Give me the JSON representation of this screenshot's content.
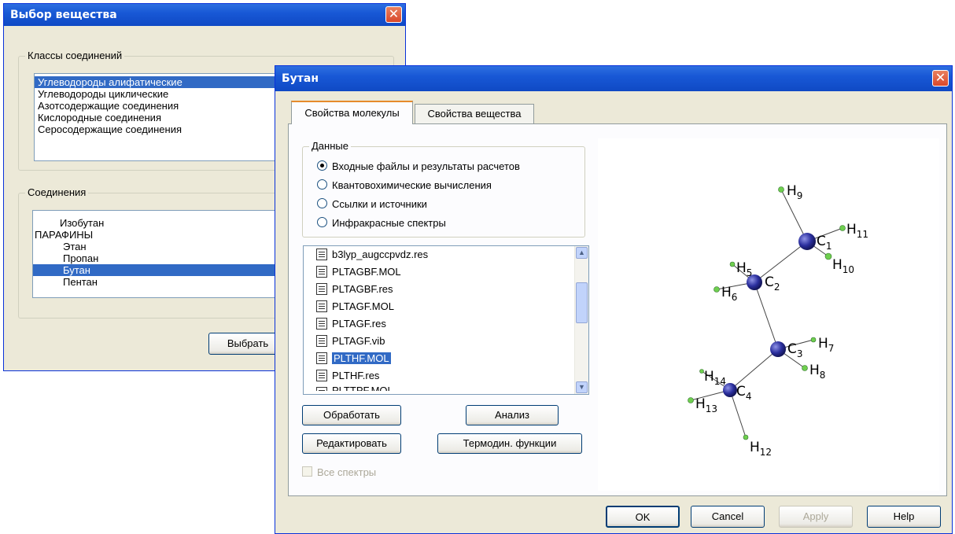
{
  "back_dialog": {
    "title": "Выбор вещества",
    "close": "✕",
    "classes_group": "Классы соединений",
    "classes": [
      "Углеводороды алифатические",
      "Углеводороды циклические",
      "Азотсодержащие соединения",
      "Кислородные соединения",
      "Серосодержащие соединения"
    ],
    "compounds_group": "Соединения",
    "compounds": [
      "Изобутан",
      "ПАРАФИНЫ",
      "Этан",
      "Пропан",
      "Бутан",
      "Пентан"
    ],
    "select_button": "Выбрать"
  },
  "front_dialog": {
    "title": "Бутан",
    "close": "✕",
    "tabs": [
      "Свойства молекулы",
      "Свойства вещества"
    ],
    "data_group": "Данные",
    "radios": [
      "Входные файлы и результаты расчетов",
      "Квантовохимические вычисления",
      "Ссылки и источники",
      "Инфракрасные спектры"
    ],
    "selected_radio": 0,
    "files": [
      "b3lyp_augccpvdz.res",
      "PLTAGBF.MOL",
      "PLTAGBF.res",
      "PLTAGF.MOL",
      "PLTAGF.res",
      "PLTAGF.vib",
      "PLTHF.MOL",
      "PLTHF.res",
      "PLTTPF.MOL"
    ],
    "selected_file": 6,
    "buttons": {
      "process": "Обработать",
      "analysis": "Анализ",
      "edit": "Редактировать",
      "thermo": "Термодин. функции"
    },
    "all_spectra": "Все спектры",
    "footer": {
      "ok": "OK",
      "cancel": "Cancel",
      "apply": "Apply",
      "help": "Help"
    }
  },
  "molecule": {
    "atom_color": "#2b2f9e",
    "hydrogen_color": "#6fcf4f",
    "labels": {
      "C1": {
        "el": "C",
        "n": "1"
      },
      "C2": {
        "el": "C",
        "n": "2"
      },
      "C3": {
        "el": "C",
        "n": "3"
      },
      "C4": {
        "el": "C",
        "n": "4"
      },
      "H5": {
        "el": "H",
        "n": "5"
      },
      "H6": {
        "el": "H",
        "n": "6"
      },
      "H7": {
        "el": "H",
        "n": "7"
      },
      "H8": {
        "el": "H",
        "n": "8"
      },
      "H9": {
        "el": "H",
        "n": "9"
      },
      "H10": {
        "el": "H",
        "n": "10"
      },
      "H11": {
        "el": "H",
        "n": "11"
      },
      "H12": {
        "el": "H",
        "n": "12"
      },
      "H13": {
        "el": "H",
        "n": "13"
      },
      "H14": {
        "el": "H",
        "n": "14"
      }
    }
  }
}
